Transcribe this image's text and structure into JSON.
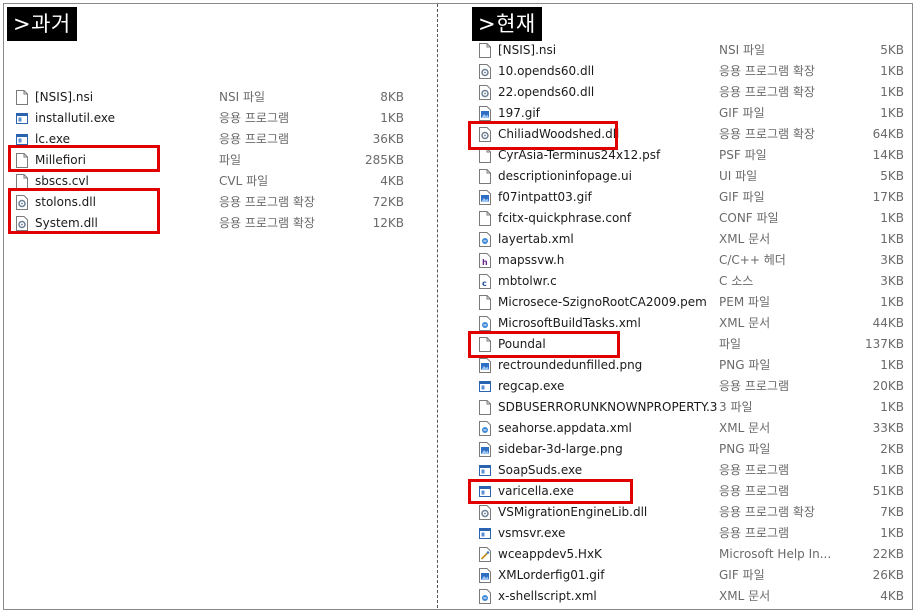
{
  "panels": [
    {
      "label": ">과거",
      "files": [
        {
          "name": "[NSIS].nsi",
          "type": "NSI 파일",
          "size": "8KB",
          "icon": "document-icon"
        },
        {
          "name": "installutil.exe",
          "type": "응용 프로그램",
          "size": "1KB",
          "icon": "app-window-icon"
        },
        {
          "name": "lc.exe",
          "type": "응용 프로그램",
          "size": "36KB",
          "icon": "app-window-icon"
        },
        {
          "name": "Millefiori",
          "type": "파일",
          "size": "285KB",
          "icon": "document-icon"
        },
        {
          "name": "sbscs.cvl",
          "type": "CVL 파일",
          "size": "4KB",
          "icon": "document-icon"
        },
        {
          "name": "stolons.dll",
          "type": "응용 프로그램 확장",
          "size": "72KB",
          "icon": "dll-gear-icon"
        },
        {
          "name": "System.dll",
          "type": "응용 프로그램 확장",
          "size": "12KB",
          "icon": "dll-gear-icon"
        }
      ]
    },
    {
      "label": ">현재",
      "files": [
        {
          "name": "[NSIS].nsi",
          "type": "NSI 파일",
          "size": "5KB",
          "icon": "document-icon"
        },
        {
          "name": "10.opends60.dll",
          "type": "응용 프로그램 확장",
          "size": "1KB",
          "icon": "dll-gear-icon"
        },
        {
          "name": "22.opends60.dll",
          "type": "응용 프로그램 확장",
          "size": "1KB",
          "icon": "dll-gear-icon"
        },
        {
          "name": "197.gif",
          "type": "GIF 파일",
          "size": "1KB",
          "icon": "image-icon"
        },
        {
          "name": "ChiliadWoodshed.dll",
          "type": "응용 프로그램 확장",
          "size": "64KB",
          "icon": "dll-gear-icon"
        },
        {
          "name": "CyrAsia-Terminus24x12.psf",
          "type": "PSF 파일",
          "size": "14KB",
          "icon": "document-icon"
        },
        {
          "name": "descriptioninfopage.ui",
          "type": "UI 파일",
          "size": "5KB",
          "icon": "document-icon"
        },
        {
          "name": "f07intpatt03.gif",
          "type": "GIF 파일",
          "size": "17KB",
          "icon": "image-icon"
        },
        {
          "name": "fcitx-quickphrase.conf",
          "type": "CONF 파일",
          "size": "1KB",
          "icon": "document-icon"
        },
        {
          "name": "layertab.xml",
          "type": "XML 문서",
          "size": "1KB",
          "icon": "xml-icon"
        },
        {
          "name": "mapssvw.h",
          "type": "C/C++ 헤더",
          "size": "3KB",
          "icon": "header-h-icon"
        },
        {
          "name": "mbtolwr.c",
          "type": "C 소스",
          "size": "3KB",
          "icon": "c-source-icon"
        },
        {
          "name": "Microsece-SzignoRootCA2009.pem",
          "type": "PEM 파일",
          "size": "1KB",
          "icon": "document-icon"
        },
        {
          "name": "MicrosoftBuildTasks.xml",
          "type": "XML 문서",
          "size": "44KB",
          "icon": "xml-icon"
        },
        {
          "name": "Poundal",
          "type": "파일",
          "size": "137KB",
          "icon": "document-icon"
        },
        {
          "name": "rectroundedunfilled.png",
          "type": "PNG 파일",
          "size": "1KB",
          "icon": "image-icon"
        },
        {
          "name": "regcap.exe",
          "type": "응용 프로그램",
          "size": "20KB",
          "icon": "app-window-icon"
        },
        {
          "name": "SDBUSERRORUNKNOWNPROPERTY.3",
          "type": "3 파일",
          "size": "1KB",
          "icon": "document-icon"
        },
        {
          "name": "seahorse.appdata.xml",
          "type": "XML 문서",
          "size": "33KB",
          "icon": "xml-icon"
        },
        {
          "name": "sidebar-3d-large.png",
          "type": "PNG 파일",
          "size": "2KB",
          "icon": "image-icon"
        },
        {
          "name": "SoapSuds.exe",
          "type": "응용 프로그램",
          "size": "1KB",
          "icon": "app-window-icon"
        },
        {
          "name": "varicella.exe",
          "type": "응용 프로그램",
          "size": "51KB",
          "icon": "app-window-icon"
        },
        {
          "name": "VSMigrationEngineLib.dll",
          "type": "응용 프로그램 확장",
          "size": "7KB",
          "icon": "dll-gear-icon"
        },
        {
          "name": "vsmsvr.exe",
          "type": "응용 프로그램",
          "size": "1KB",
          "icon": "app-window-icon"
        },
        {
          "name": "wceappdev5.HxK",
          "type": "Microsoft Help In...",
          "size": "22KB",
          "icon": "help-icon"
        },
        {
          "name": "XMLorderfig01.gif",
          "type": "GIF 파일",
          "size": "26KB",
          "icon": "image-icon"
        },
        {
          "name": "x-shellscript.xml",
          "type": "XML 문서",
          "size": "4KB",
          "icon": "xml-icon"
        }
      ]
    }
  ],
  "colors": {
    "highlight": "#e00000",
    "badge_bg": "#000000",
    "badge_fg": "#ffffff",
    "muted": "#6a6a6a"
  }
}
